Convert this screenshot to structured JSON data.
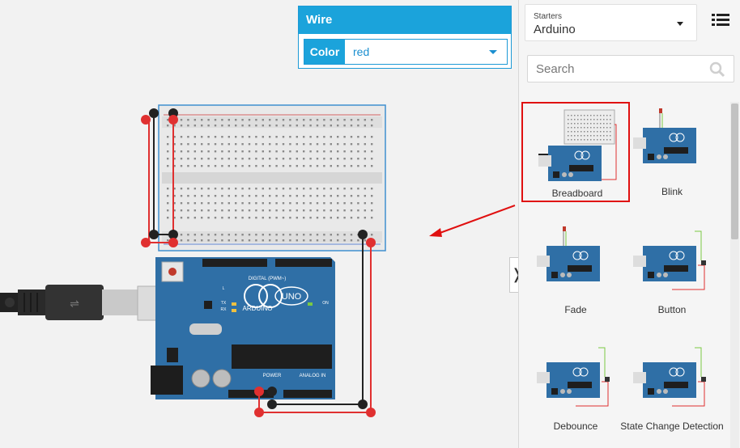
{
  "wire_panel": {
    "title": "Wire",
    "color_label": "Color",
    "color_value": "red"
  },
  "sidebar": {
    "starters_label": "Starters",
    "starters_value": "Arduino",
    "search_placeholder": "Search",
    "collapse_glyph": "❭",
    "tiles": [
      {
        "label": "Breadboard",
        "selected": true
      },
      {
        "label": "Blink"
      },
      {
        "label": "Fade"
      },
      {
        "label": "Button"
      },
      {
        "label": "Debounce"
      },
      {
        "label": "State Change Detection"
      }
    ]
  },
  "board": {
    "brand": "ARDUINO",
    "model": "UNO",
    "digital_label": "DIGITAL (PWM~)",
    "power_label": "POWER",
    "analog_label": "ANALOG IN",
    "on_label": "ON",
    "tx_label": "TX",
    "rx_label": "RX",
    "l_label": "L"
  },
  "colors": {
    "accent": "#1ba3db",
    "wire_red": "#e03030",
    "wire_black": "#222222",
    "board_blue": "#2f6fa6"
  }
}
